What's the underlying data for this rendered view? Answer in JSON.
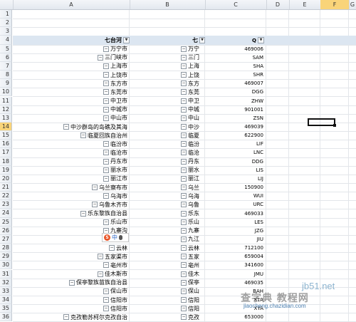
{
  "columns": [
    "A",
    "B",
    "C",
    "D",
    "E",
    "F",
    "G"
  ],
  "selected_column": "F",
  "selected_row": "14",
  "pivot_header": {
    "row": "4",
    "col_a": "七台河",
    "col_b": "七",
    "col_c": "Q"
  },
  "empty_rows": [
    "1",
    "2",
    "3"
  ],
  "rows": [
    {
      "n": "5",
      "a": "万宁市",
      "b": "万宁",
      "c": "469006"
    },
    {
      "n": "6",
      "a": "三门峡市",
      "b": "三门",
      "c": "SAM"
    },
    {
      "n": "7",
      "a": "上海市",
      "b": "上海",
      "c": "SHA"
    },
    {
      "n": "8",
      "a": "上饶市",
      "b": "上饶",
      "c": "SHR"
    },
    {
      "n": "9",
      "a": "东方市",
      "b": "东方",
      "c": "469007"
    },
    {
      "n": "10",
      "a": "东莞市",
      "b": "东莞",
      "c": "DGG"
    },
    {
      "n": "11",
      "a": "中卫市",
      "b": "中卫",
      "c": "ZHW"
    },
    {
      "n": "12",
      "a": "中城市",
      "b": "中城",
      "c": "901001"
    },
    {
      "n": "13",
      "a": "中山市",
      "b": "中山",
      "c": "ZSN"
    },
    {
      "n": "14",
      "a": "中沙群岛的岛礁及其海",
      "b": "中沙",
      "c": "469039"
    },
    {
      "n": "15",
      "a": "临夏回族自治州",
      "b": "临夏",
      "c": "622900"
    },
    {
      "n": "16",
      "a": "临汾市",
      "b": "临汾",
      "c": "LIF"
    },
    {
      "n": "17",
      "a": "临沧市",
      "b": "临沧",
      "c": "LNC"
    },
    {
      "n": "18",
      "a": "丹东市",
      "b": "丹东",
      "c": "DDG"
    },
    {
      "n": "19",
      "a": "丽水市",
      "b": "丽水",
      "c": "LIS"
    },
    {
      "n": "20",
      "a": "丽江市",
      "b": "丽江",
      "c": "LIJ"
    },
    {
      "n": "21",
      "a": "乌兰察布市",
      "b": "乌兰",
      "c": "150900"
    },
    {
      "n": "22",
      "a": "乌海市",
      "b": "乌海",
      "c": "WUI"
    },
    {
      "n": "23",
      "a": "乌鲁木齐市",
      "b": "乌鲁",
      "c": "URC"
    },
    {
      "n": "24",
      "a": "乐东黎族自治县",
      "b": "乐东",
      "c": "469033"
    },
    {
      "n": "25",
      "a": "乐山市",
      "b": "乐山",
      "c": "LES"
    },
    {
      "n": "26",
      "a": "九寨沟",
      "b": "九寨",
      "c": "JZG"
    },
    {
      "n": "27",
      "a": "九江市",
      "b": "九江",
      "c": "JIU"
    },
    {
      "n": "28",
      "a": "云林",
      "b": "云林",
      "c": "712100"
    },
    {
      "n": "29",
      "a": "五家渠市",
      "b": "五家",
      "c": "659004"
    },
    {
      "n": "30",
      "a": "亳州市",
      "b": "亳州",
      "c": "341600"
    },
    {
      "n": "31",
      "a": "佳木斯市",
      "b": "佳木",
      "c": "JMU"
    },
    {
      "n": "32",
      "a": "保亭黎族苗族自治县",
      "b": "保亭",
      "c": "469035"
    },
    {
      "n": "33",
      "a": "保山市",
      "b": "保山",
      "c": "BAH"
    },
    {
      "n": "34",
      "a": "信阳市",
      "b": "信阳",
      "c": "X1A"
    },
    {
      "n": "35",
      "a": "信阳市",
      "b": "信阳",
      "c": "XYA"
    },
    {
      "n": "36",
      "a": "克孜勒苏柯尔克孜自治",
      "b": "克孜",
      "c": "653000"
    }
  ],
  "ime": {
    "s": "S",
    "zh": "中"
  },
  "watermark": {
    "site": "jb51.net",
    "cn": "查字典 教程网",
    "url": "jiaocheng.chazidian.com"
  }
}
